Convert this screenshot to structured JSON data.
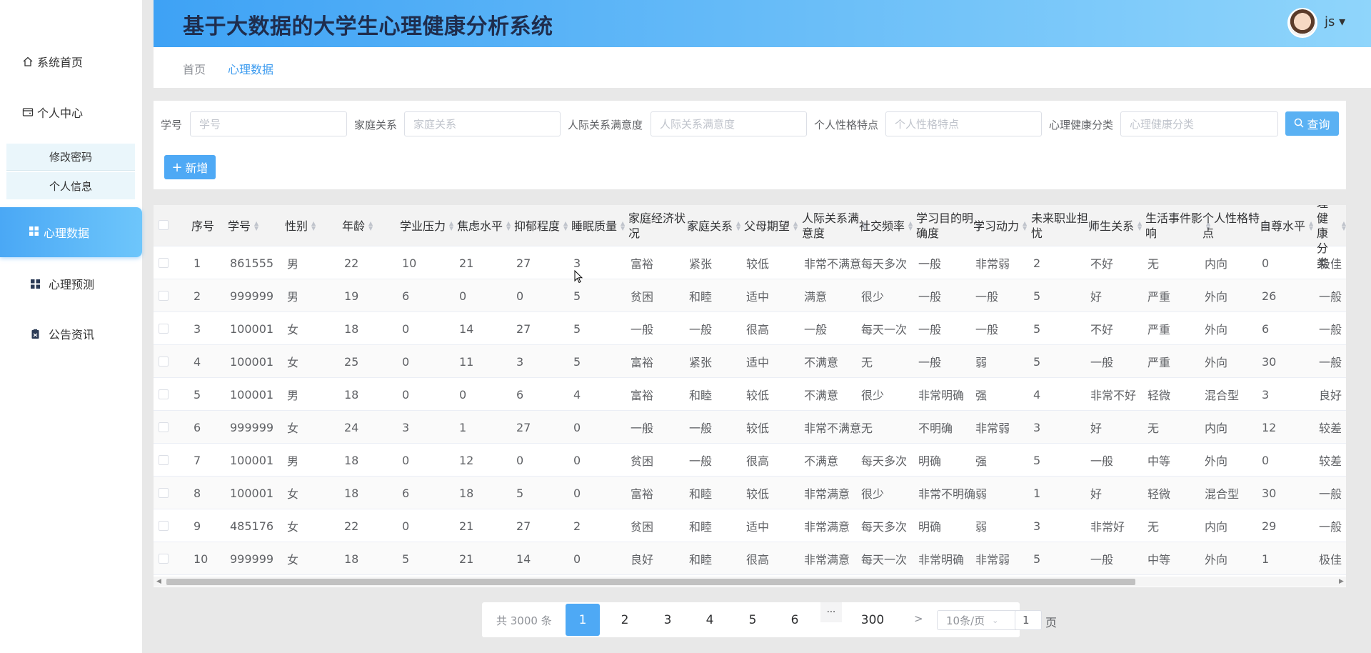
{
  "app": {
    "title": "基于大数据的大学生心理健康分析系统",
    "user": "js ▾"
  },
  "sidebar": {
    "home": "系统首页",
    "center": "个人中心",
    "change_password": "修改密码",
    "personal_info": "个人信息",
    "psych_data": "心理数据",
    "psych_predict": "心理预测",
    "notice": "公告资讯"
  },
  "breadcrumb": {
    "home": "首页",
    "current": "心理数据"
  },
  "search": {
    "student_id_label": "学号",
    "student_id_placeholder": "学号",
    "family_label": "家庭关系",
    "family_placeholder": "家庭关系",
    "interpersonal_label": "人际关系满意度",
    "interpersonal_placeholder": "人际关系满意度",
    "personality_label": "个人性格特点",
    "personality_placeholder": "个人性格特点",
    "health_label": "心理健康分类",
    "health_placeholder": "心理健康分类",
    "query_label": "查询",
    "add_label": "新增"
  },
  "table": {
    "headers": [
      "序号",
      "学号",
      "性别",
      "年龄",
      "学业压力",
      "焦虑水平",
      "抑郁程度",
      "睡眠质量",
      "家庭经济状况",
      "家庭关系",
      "父母期望",
      "人际关系满意度",
      "社交频率",
      "学习目的明确度",
      "学习动力",
      "未来职业担忧",
      "师生关系",
      "生活事件影响",
      "个人性格特点",
      "自尊水平",
      "心理健康分类"
    ],
    "rows": [
      [
        "1",
        "861555",
        "男",
        "22",
        "10",
        "21",
        "27",
        "3",
        "富裕",
        "紧张",
        "较低",
        "非常不满意",
        "每天多次",
        "一般",
        "非常弱",
        "2",
        "不好",
        "无",
        "内向",
        "0",
        "极佳"
      ],
      [
        "2",
        "999999",
        "男",
        "19",
        "6",
        "0",
        "0",
        "5",
        "贫困",
        "和睦",
        "适中",
        "满意",
        "很少",
        "一般",
        "一般",
        "5",
        "好",
        "严重",
        "外向",
        "26",
        "一般"
      ],
      [
        "3",
        "100001",
        "女",
        "18",
        "0",
        "14",
        "27",
        "5",
        "一般",
        "一般",
        "很高",
        "一般",
        "每天一次",
        "一般",
        "一般",
        "5",
        "不好",
        "严重",
        "外向",
        "6",
        "一般"
      ],
      [
        "4",
        "100001",
        "女",
        "25",
        "0",
        "11",
        "3",
        "5",
        "富裕",
        "紧张",
        "适中",
        "不满意",
        "无",
        "一般",
        "弱",
        "5",
        "一般",
        "严重",
        "外向",
        "30",
        "一般"
      ],
      [
        "5",
        "100001",
        "男",
        "18",
        "0",
        "0",
        "6",
        "4",
        "富裕",
        "和睦",
        "较低",
        "不满意",
        "很少",
        "非常明确",
        "强",
        "4",
        "非常不好",
        "轻微",
        "混合型",
        "3",
        "良好"
      ],
      [
        "6",
        "999999",
        "女",
        "24",
        "3",
        "1",
        "27",
        "0",
        "一般",
        "一般",
        "较低",
        "非常不满意",
        "无",
        "不明确",
        "非常弱",
        "3",
        "好",
        "无",
        "内向",
        "12",
        "较差"
      ],
      [
        "7",
        "100001",
        "男",
        "18",
        "0",
        "12",
        "0",
        "0",
        "贫困",
        "一般",
        "很高",
        "不满意",
        "每天多次",
        "明确",
        "强",
        "5",
        "一般",
        "中等",
        "外向",
        "0",
        "较差"
      ],
      [
        "8",
        "100001",
        "女",
        "18",
        "6",
        "18",
        "5",
        "0",
        "富裕",
        "和睦",
        "较低",
        "非常满意",
        "很少",
        "非常不明确",
        "弱",
        "1",
        "好",
        "轻微",
        "混合型",
        "30",
        "一般"
      ],
      [
        "9",
        "485176",
        "女",
        "22",
        "0",
        "21",
        "27",
        "2",
        "贫困",
        "和睦",
        "适中",
        "非常满意",
        "每天多次",
        "明确",
        "弱",
        "3",
        "非常好",
        "无",
        "内向",
        "29",
        "一般"
      ],
      [
        "10",
        "999999",
        "女",
        "18",
        "5",
        "21",
        "14",
        "0",
        "良好",
        "和睦",
        "很高",
        "非常满意",
        "每天一次",
        "非常明确",
        "非常弱",
        "5",
        "一般",
        "中等",
        "外向",
        "1",
        "极佳"
      ]
    ]
  },
  "pagination": {
    "total": "共 3000 条",
    "pages": [
      "1",
      "2",
      "3",
      "4",
      "5",
      "6"
    ],
    "more": "···",
    "last": "300",
    "next": ">",
    "page_size": "10条/页",
    "goto_value": "1",
    "page_suffix": "页",
    "current": 1
  },
  "colors": {
    "accent": "#4ea9f5",
    "header_start": "#3ea2f5",
    "header_end": "#8fd5fb"
  }
}
